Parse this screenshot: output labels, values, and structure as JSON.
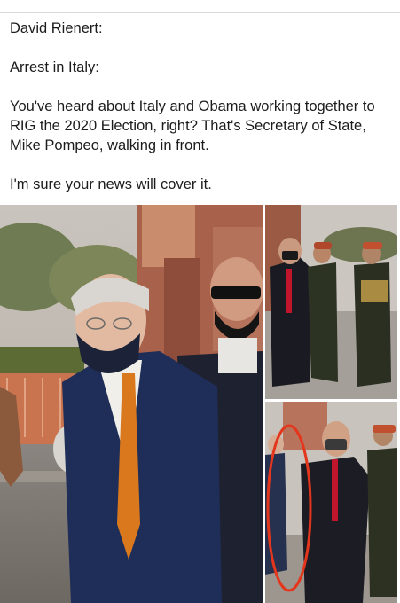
{
  "post": {
    "author_line": "David Rienert:",
    "headline": "Arrest in Italy:",
    "body": "You've heard about Italy and Obama working together to RIG the 2020 Election, right? That's Secretary of State, Mike Pompeo, walking in front.",
    "closing": "I'm sure your news will cover it."
  },
  "colors": {
    "highlight_circle": "#e3361c",
    "suit_navy": "#1f2e58",
    "tie_orange": "#d9781d"
  }
}
